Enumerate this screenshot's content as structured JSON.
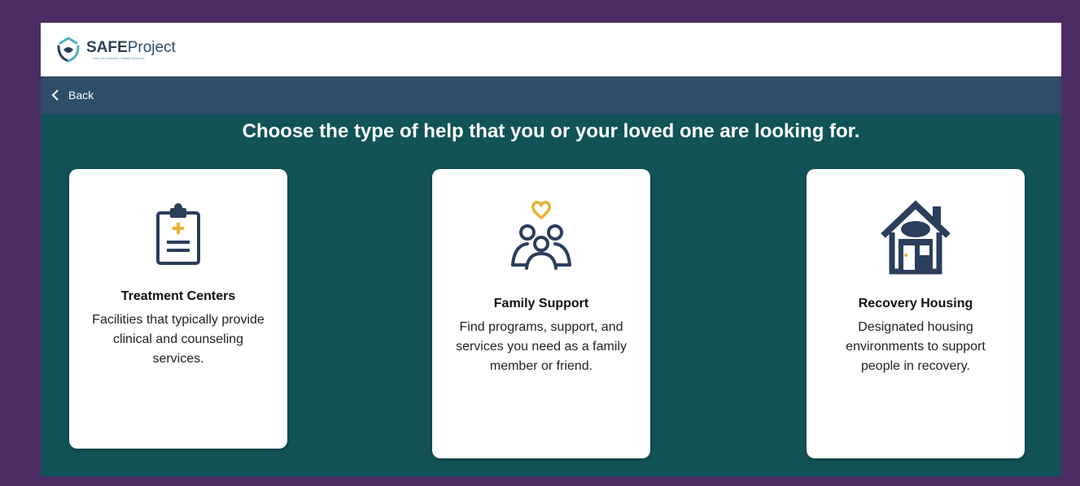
{
  "header": {
    "logo_bold": "SAFE",
    "logo_light": "Project",
    "logo_tagline": "Stop the Addiction Fatality Epidemic"
  },
  "nav": {
    "back_label": "Back"
  },
  "main": {
    "title": "Choose the type of help that you or your loved one are looking for.",
    "cards": [
      {
        "icon": "clipboard-medical-icon",
        "title": "Treatment Centers",
        "description": "Facilities that typically provide clinical and counseling services."
      },
      {
        "icon": "family-heart-icon",
        "title": "Family Support",
        "description": "Find programs, support, and services you need as a family member or friend."
      },
      {
        "icon": "house-icon",
        "title": "Recovery Housing",
        "description": "Designated housing environments to support people in recovery."
      }
    ]
  },
  "colors": {
    "page_border": "#4b2d63",
    "background": "#115357",
    "navbar": "#2f4c69",
    "icon_navy": "#2b3e5c",
    "icon_gold": "#e6b233"
  }
}
